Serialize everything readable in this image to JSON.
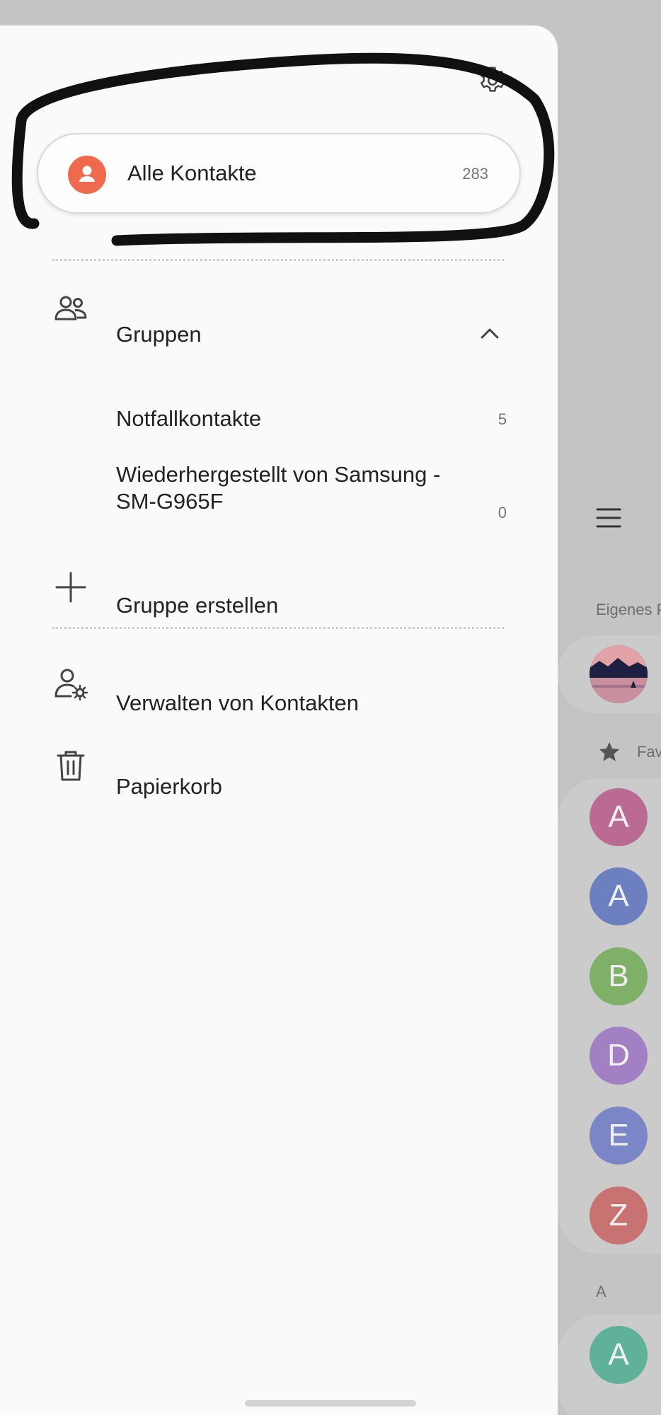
{
  "drawer": {
    "all_contacts": {
      "label": "Alle Kontakte",
      "count": "283"
    },
    "groups": {
      "label": "Gruppen",
      "items": [
        {
          "label": "Notfallkontakte",
          "count": "5"
        },
        {
          "label": "Wiederhergestellt von Samsung - SM-G965F",
          "count": "0"
        }
      ]
    },
    "create_group": {
      "label": "Gruppe erstellen"
    },
    "manage_contacts": {
      "label": "Verwalten von Kontakten"
    },
    "trash": {
      "label": "Papierkorb"
    }
  },
  "background": {
    "own_profile_label": "Eigenes P",
    "favorites_label": "Fav",
    "section_a_label": "A",
    "favorites": [
      {
        "initial": "A",
        "color": "#bb6a94"
      },
      {
        "initial": "A",
        "color": "#6c7fbf"
      },
      {
        "initial": "B",
        "color": "#7eb067"
      },
      {
        "initial": "D",
        "color": "#a380c4"
      },
      {
        "initial": "E",
        "color": "#7b86c7"
      },
      {
        "initial": "Z",
        "color": "#c87272"
      }
    ],
    "section_a_contacts": [
      {
        "initial": "A",
        "color": "#5fb19a"
      }
    ]
  },
  "colors": {
    "accent": "#ef6a4d",
    "drawer_bg": "#fafafa",
    "scrim_bg": "#c4c4c4"
  },
  "icons": {
    "settings": "gear-icon",
    "all_contacts": "person-icon",
    "groups": "group-icon",
    "collapse": "chevron-up-icon",
    "create_group": "plus-icon",
    "manage_contacts": "person-gear-icon",
    "trash": "trash-icon",
    "menu": "hamburger-icon",
    "favorites": "star-icon"
  }
}
